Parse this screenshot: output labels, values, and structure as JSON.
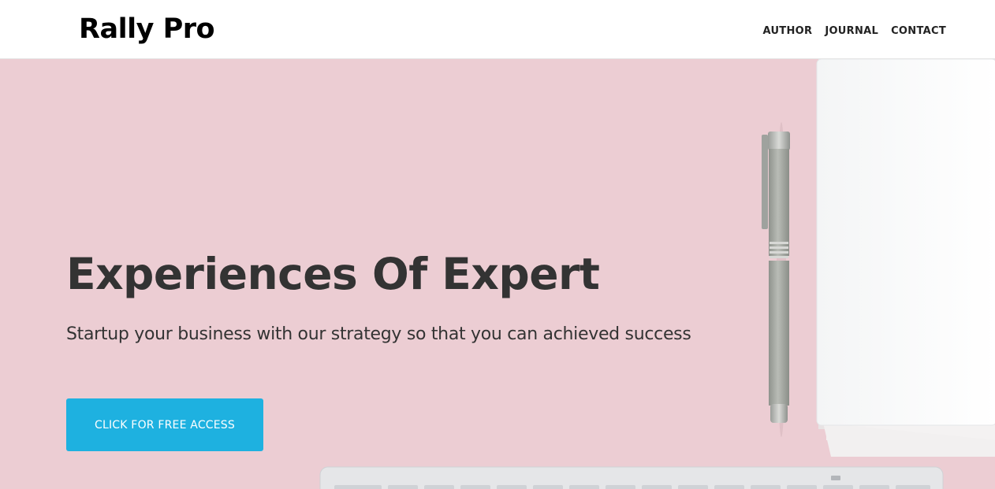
{
  "brand": {
    "name": "Rally Pro"
  },
  "nav": {
    "items": [
      "AUTHOR",
      "JOURNAL",
      "CONTACT"
    ]
  },
  "hero": {
    "headline": "Experiences Of Expert",
    "subline": "Startup your business with our strategy so that you can achieved success",
    "cta_label": "CLICK FOR FREE ACCESS"
  },
  "colors": {
    "hero_background": "#eccdd3",
    "cta": "#1eb1e0",
    "heading_text": "#333333"
  }
}
